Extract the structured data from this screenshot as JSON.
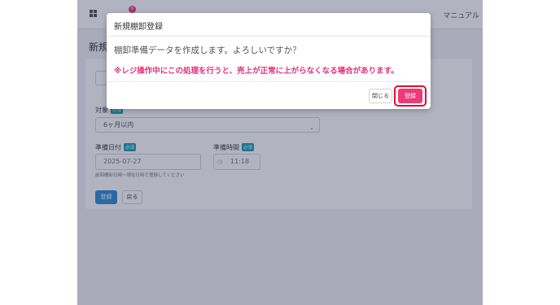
{
  "topbar": {
    "notification_count": "6",
    "manual_label": "マニュアル"
  },
  "page": {
    "title": "新規",
    "form": {
      "target_label": "対象",
      "target_required": "必須",
      "target_value": "6ヶ月以内",
      "date_label": "準備日付",
      "date_required": "必須",
      "date_value": "2025-07-27",
      "date_hint": "前回棚卸日時～現在日時で登録してください",
      "time_label": "準備時間",
      "time_required": "必須",
      "time_value": "11:18",
      "submit_label": "登録",
      "back_label": "戻る"
    }
  },
  "modal": {
    "title": "新規棚卸登録",
    "question": "棚卸準備データを作成します。よろしいですか？",
    "warning": "※レジ操作中にこの処理を行うと、売上が正常に上がらなくなる場合があります。",
    "close_label": "閉じる",
    "register_label": "登録"
  },
  "colors": {
    "accent_pink": "#ee3a7a",
    "warning_pink": "#e4317a",
    "highlight_red": "#e0102a",
    "primary_blue": "#2f8fd8",
    "badge_teal": "#17a2b8"
  }
}
